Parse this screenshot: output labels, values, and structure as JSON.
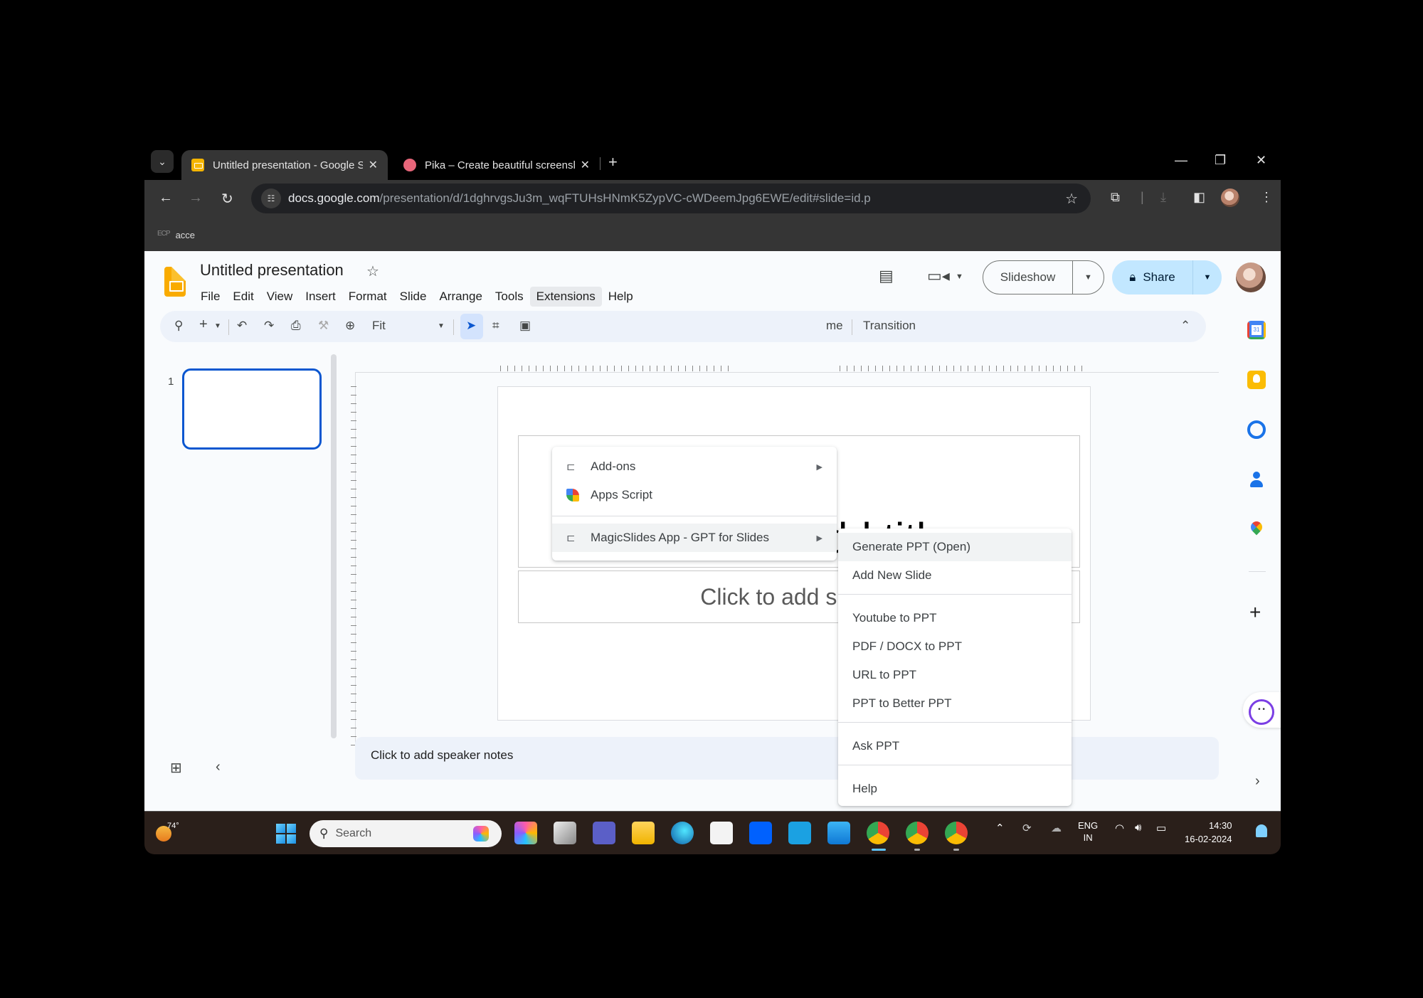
{
  "browser": {
    "tabs": [
      {
        "title": "Untitled presentation - Google Slides",
        "active": true,
        "favicon": "slides-icon"
      },
      {
        "title": "Pika – Create beautiful screenshots",
        "active": false,
        "favicon": "pika-icon"
      }
    ],
    "new_tab": "+",
    "window_controls": {
      "minimize": "—",
      "restore": "❐",
      "close": "✕"
    },
    "url_host": "docs.google.com",
    "url_path": "/presentation/d/1dghrvgsJu3m_wqFTUHsHNmK5ZypVC-cWDeemJpg6EWE/edit#slide=id.p",
    "bookmark": {
      "icon_text": "ECP",
      "label": "acce"
    }
  },
  "slides": {
    "doc_title": "Untitled presentation",
    "menus": [
      "File",
      "Edit",
      "View",
      "Insert",
      "Format",
      "Slide",
      "Arrange",
      "Tools",
      "Extensions",
      "Help"
    ],
    "open_menu": "Extensions",
    "slideshow_label": "Slideshow",
    "share_label": "Share",
    "toolbar": {
      "zoom_value": "Fit",
      "theme_partial": "me",
      "transition_label": "Transition"
    },
    "slide_number": "1",
    "title_placeholder": "Click to add title",
    "subtitle_placeholder": "Click to add subtitle",
    "speaker_notes_placeholder": "Click to add speaker notes"
  },
  "extensions_menu": {
    "items": [
      {
        "label": "Add-ons",
        "icon": "addon-icon",
        "has_submenu": true
      },
      {
        "label": "Apps Script",
        "icon": "apps-script-icon",
        "has_submenu": false
      },
      {
        "label": "MagicSlides App - GPT for Slides",
        "icon": "addon-icon",
        "has_submenu": true,
        "highlighted": true
      }
    ]
  },
  "magicslides_submenu": {
    "items": [
      {
        "label": "Generate PPT (Open)",
        "highlighted": true
      },
      {
        "label": "Add New Slide"
      },
      {
        "label": "Youtube to PPT"
      },
      {
        "label": "PDF / DOCX to PPT"
      },
      {
        "label": "URL to PPT"
      },
      {
        "label": "PPT to Better PPT"
      },
      {
        "label": "Ask PPT"
      },
      {
        "label": "Help"
      }
    ]
  },
  "taskbar": {
    "weather_temp": "74°",
    "search_placeholder": "Search",
    "lang_line1": "ENG",
    "lang_line2": "IN",
    "time": "14:30",
    "date": "16-02-2024"
  },
  "colors": {
    "accent_blue": "#0b57d0",
    "share_bg": "#c2e7ff",
    "slides_yellow": "#f9ab00",
    "menu_hover": "#f1f3f4"
  }
}
